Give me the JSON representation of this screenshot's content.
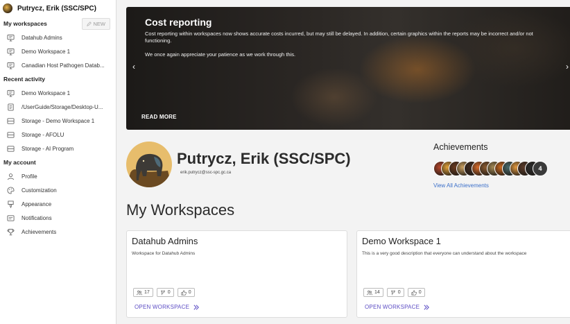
{
  "user": {
    "name": "Putrycz, Erik (SSC/SPC)"
  },
  "sidebar": {
    "workspaces_heading": "My workspaces",
    "new_label": "NEW",
    "workspaces": [
      {
        "label": "Datahub Admins",
        "icon": "monitor-icon"
      },
      {
        "label": "Demo Workspace 1",
        "icon": "monitor-icon"
      },
      {
        "label": "Canadian Host Pathogen Datab...",
        "icon": "monitor-icon"
      }
    ],
    "recent_heading": "Recent activity",
    "recent": [
      {
        "label": "Demo Workspace 1",
        "icon": "monitor-icon"
      },
      {
        "label": "/UserGuide/Storage/Desktop-U...",
        "icon": "file-icon"
      },
      {
        "label": "Storage - Demo Workspace 1",
        "icon": "storage-icon"
      },
      {
        "label": "Storage - AFOLU",
        "icon": "storage-icon"
      },
      {
        "label": "Storage - AI Program",
        "icon": "storage-icon"
      }
    ],
    "account_heading": "My account",
    "account": [
      {
        "label": "Profile",
        "icon": "person-icon"
      },
      {
        "label": "Customization",
        "icon": "palette-icon"
      },
      {
        "label": "Appearance",
        "icon": "paintbrush-icon"
      },
      {
        "label": "Notifications",
        "icon": "notification-icon"
      },
      {
        "label": "Achievements",
        "icon": "trophy-icon"
      }
    ]
  },
  "banner": {
    "title": "Cost reporting",
    "paragraph1": "Cost reporting within workspaces now shows accurate costs incurred, but may still be delayed. In addition, certain graphics within the reports may be incorrect and/or not functioning.",
    "paragraph2": "We once again appreciate your patience as we work through this.",
    "read_more": "READ MORE",
    "prev_arrow": "‹",
    "next_arrow": "›"
  },
  "profile": {
    "name": "Putrycz, Erik (SSC/SPC)",
    "email": "erik.putrycz@ssc-spc.gc.ca"
  },
  "achievements": {
    "title": "Achievements",
    "more_count": "4",
    "link": "View All Achievements",
    "badge_colors": [
      "#b5452a",
      "#e3a23a",
      "#6a3a1e",
      "#caa060",
      "#3f2a1f",
      "#d86b2a",
      "#8a5a30",
      "#a58a55",
      "#c9681f",
      "#4a6a6a",
      "#e39a40",
      "#5a3a28",
      "#2c2c2c"
    ]
  },
  "workspaces_heading": "My Workspaces",
  "workspace_cards": [
    {
      "title": "Datahub Admins",
      "description": "Workspace for Datahub Admins",
      "members": "17",
      "forks": "0",
      "likes": "0",
      "open_label": "OPEN WORKSPACE"
    },
    {
      "title": "Demo Workspace 1",
      "description": "This is a very good description that everyone can understand about the workspace",
      "members": "14",
      "forks": "0",
      "likes": "0",
      "open_label": "OPEN WORKSPACE"
    }
  ],
  "colors": {
    "accent_link": "#5b4cc4",
    "achievement_link": "#3b6fc9",
    "banner_bg": "#2b2724"
  }
}
